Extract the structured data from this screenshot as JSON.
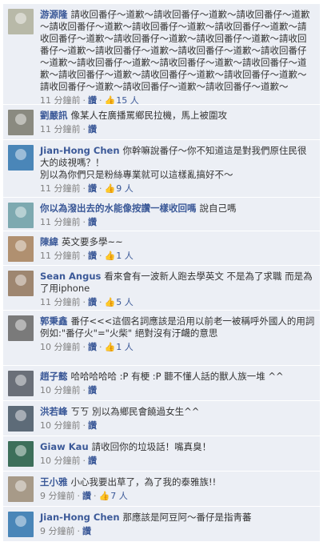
{
  "comments": [
    {
      "author": "游源隆",
      "text": "請收回番仔～道歉～請收回番仔～道歉～請收回番仔～道歉～請收回番仔～道歉～請收回番仔～道歉～請收回番仔～道歉～請收回番仔～道歉～請收回番仔～道歉～請收回番仔～道歉～請收回番仔～道歉～請收回番仔～道歉～請收回番仔～道歉～請收回番仔～道歉～請收回番仔～道歉～請收回番仔～道歉～請收回番仔～道歉～請收回番仔～道歉～請收回番仔～道歉～請收回番仔～道歉～請收回番仔～道歉～請收回番仔～道歉～請收回番仔～道歉～",
      "time": "11 分鐘前",
      "like": "讚",
      "count": "15 人",
      "avatar_color": "#b8b9a8",
      "height": 126
    },
    {
      "author": "劉嚴訊",
      "text": "像某人在廣播罵鄉民拉機，馬上被圍攻",
      "time": "11 分鐘前",
      "like": "讚",
      "count": "",
      "avatar_color": "#8a8a80",
      "height": 44
    },
    {
      "author": "Jian-Hong Chen",
      "text": "你幹嘛說番仔～你不知道這是對我們原住民很大的歧視嗎？！\n別以為你們只是粉絲專業就可以這樣亂搞好不～",
      "time": "11 分鐘前",
      "like": "讚",
      "count": "9 人",
      "avatar_color": "#4a86b8",
      "height": 72
    },
    {
      "author": "你以為潑出去的水能像按讚一樣收回嗎",
      "text": "說自己嗎",
      "time": "11 分鐘前",
      "like": "讚",
      "count": "",
      "avatar_color": "#7da9b0",
      "height": 42
    },
    {
      "author": "陳緯",
      "text": "英文要多學~~",
      "time": "11 分鐘前",
      "like": "讚",
      "count": "1 人",
      "avatar_color": "#b09070",
      "height": 43
    },
    {
      "author": "Sean Angus",
      "text": "看來會有一波新人跑去學英文 不是為了求職 而是為了用iphone",
      "time": "11 分鐘前",
      "like": "讚",
      "count": "5 人",
      "avatar_color": "#9e8670",
      "height": 56
    },
    {
      "author": "郭秉鑫",
      "text": "番仔<<<這個名詞應該是沿用以前老一被稱呼外國人的用詞 例如:\"番仔火\"=\"火柴\" 絕對沒有汙衊的意思",
      "time": "10 分鐘前",
      "like": "讚",
      "count": "1 人",
      "avatar_color": "#7a7a7a",
      "height": 69
    },
    {
      "author": "趙子懿",
      "text": "哈哈哈哈哈 :P 有梗 :P 聽不懂人話的獸人族一堆 ^^",
      "time": "10 分鐘前",
      "like": "讚",
      "count": "",
      "avatar_color": "#6a6f78",
      "height": 44
    },
    {
      "author": "洪若峰",
      "text": "ㄎㄎ 別以為鄉民會饒過女生^^",
      "time": "10 分鐘前",
      "like": "讚",
      "count": "",
      "avatar_color": "#5d6b78",
      "height": 44
    },
    {
      "author": "Giaw Kau",
      "text": "請收回你的垃圾話！嘴真臭！",
      "time": "10 分鐘前",
      "like": "讚",
      "count": "",
      "avatar_color": "#3d6f5a",
      "height": 44
    },
    {
      "author": "王小雅",
      "text": "小心我要出草了，為了我的泰雅族!!",
      "time": "9 分鐘前",
      "like": "讚",
      "count": "7 人",
      "avatar_color": "#a79a88",
      "height": 44
    },
    {
      "author": "Jian-Hong Chen",
      "text": "那應該是阿豆阿～番仔是指靑蕃",
      "time": "9 分鐘前",
      "like": "讚",
      "count": "",
      "avatar_color": "#4a86b8",
      "height": 44
    }
  ]
}
